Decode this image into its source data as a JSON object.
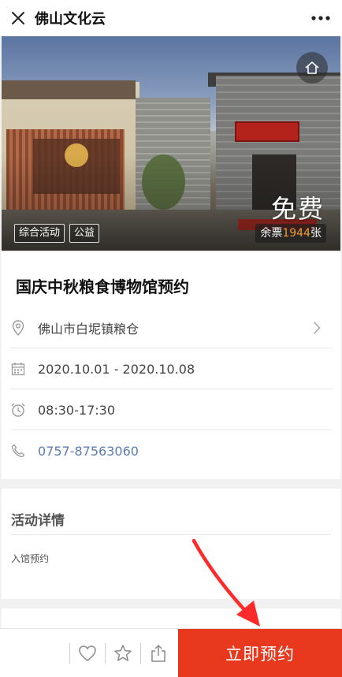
{
  "nav": {
    "title": "佛山文化云",
    "close_icon": "close-icon",
    "more_icon": "more-dots-icon"
  },
  "hero": {
    "price": "免费",
    "remaining_prefix": "余票",
    "remaining_count": "1944",
    "remaining_suffix": "张",
    "tags": [
      "综合活动",
      "公益"
    ],
    "home_icon": "home-icon"
  },
  "event": {
    "title": "国庆中秋粮食博物馆预约",
    "address": "佛山市白坭镇粮仓",
    "date_range": "2020.10.01 - 2020.10.08",
    "time_range": "08:30-17:30",
    "phone": "0757-87563060"
  },
  "details": {
    "heading": "活动详情",
    "body": "入馆预约"
  },
  "bottom_bar": {
    "reserve_label": "立即预约",
    "icons": [
      "heart-icon",
      "star-icon",
      "share-icon"
    ]
  },
  "colors": {
    "accent": "#e8391f",
    "remaining_count": "#f39b32",
    "phone_link": "#5b7cae",
    "annotation_arrow": "#ff2a2a"
  }
}
